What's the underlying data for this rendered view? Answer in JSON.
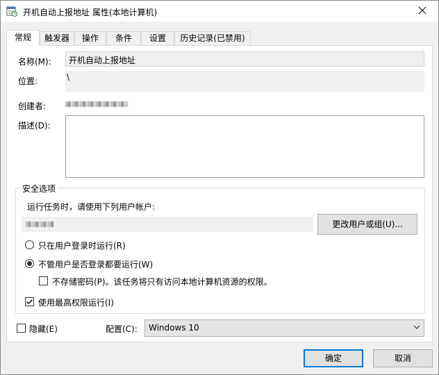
{
  "window": {
    "title": "开机自动上报地址 属性(本地计算机)",
    "icons": {
      "app": "task-scheduler-icon",
      "close": "close-icon"
    }
  },
  "tabs": [
    {
      "label": "常规",
      "active": true
    },
    {
      "label": "触发器",
      "active": false
    },
    {
      "label": "操作",
      "active": false
    },
    {
      "label": "条件",
      "active": false
    },
    {
      "label": "设置",
      "active": false
    },
    {
      "label": "历史记录(已禁用)",
      "active": false
    }
  ],
  "general": {
    "name_label": "名称(M):",
    "name_value": "开机自动上报地址",
    "location_label": "位置:",
    "location_value": "\\",
    "author_label": "创建者:",
    "description_label": "描述(D):",
    "description_value": ""
  },
  "security": {
    "legend": "安全选项",
    "run_as_prompt": "运行任务时，请使用下列用户帐户:",
    "change_user_button": "更改用户或组(U)...",
    "radio_logged_on": "只在用户登录时运行(R)",
    "radio_logged_on_checked": false,
    "radio_whether_logged_on": "不管用户是否登录都要运行(W)",
    "radio_whether_logged_on_checked": true,
    "no_store_password": "不存储密码(P)。该任务将只有访问本地计算机资源的权限。",
    "no_store_password_checked": false,
    "highest_privileges": "使用最高权限运行(I)",
    "highest_privileges_checked": true
  },
  "footer": {
    "hidden_label": "隐藏(E)",
    "hidden_checked": false,
    "configure_label": "配置(C):",
    "configure_value": "Windows 10",
    "ok_button": "确定",
    "cancel_button": "取消"
  }
}
